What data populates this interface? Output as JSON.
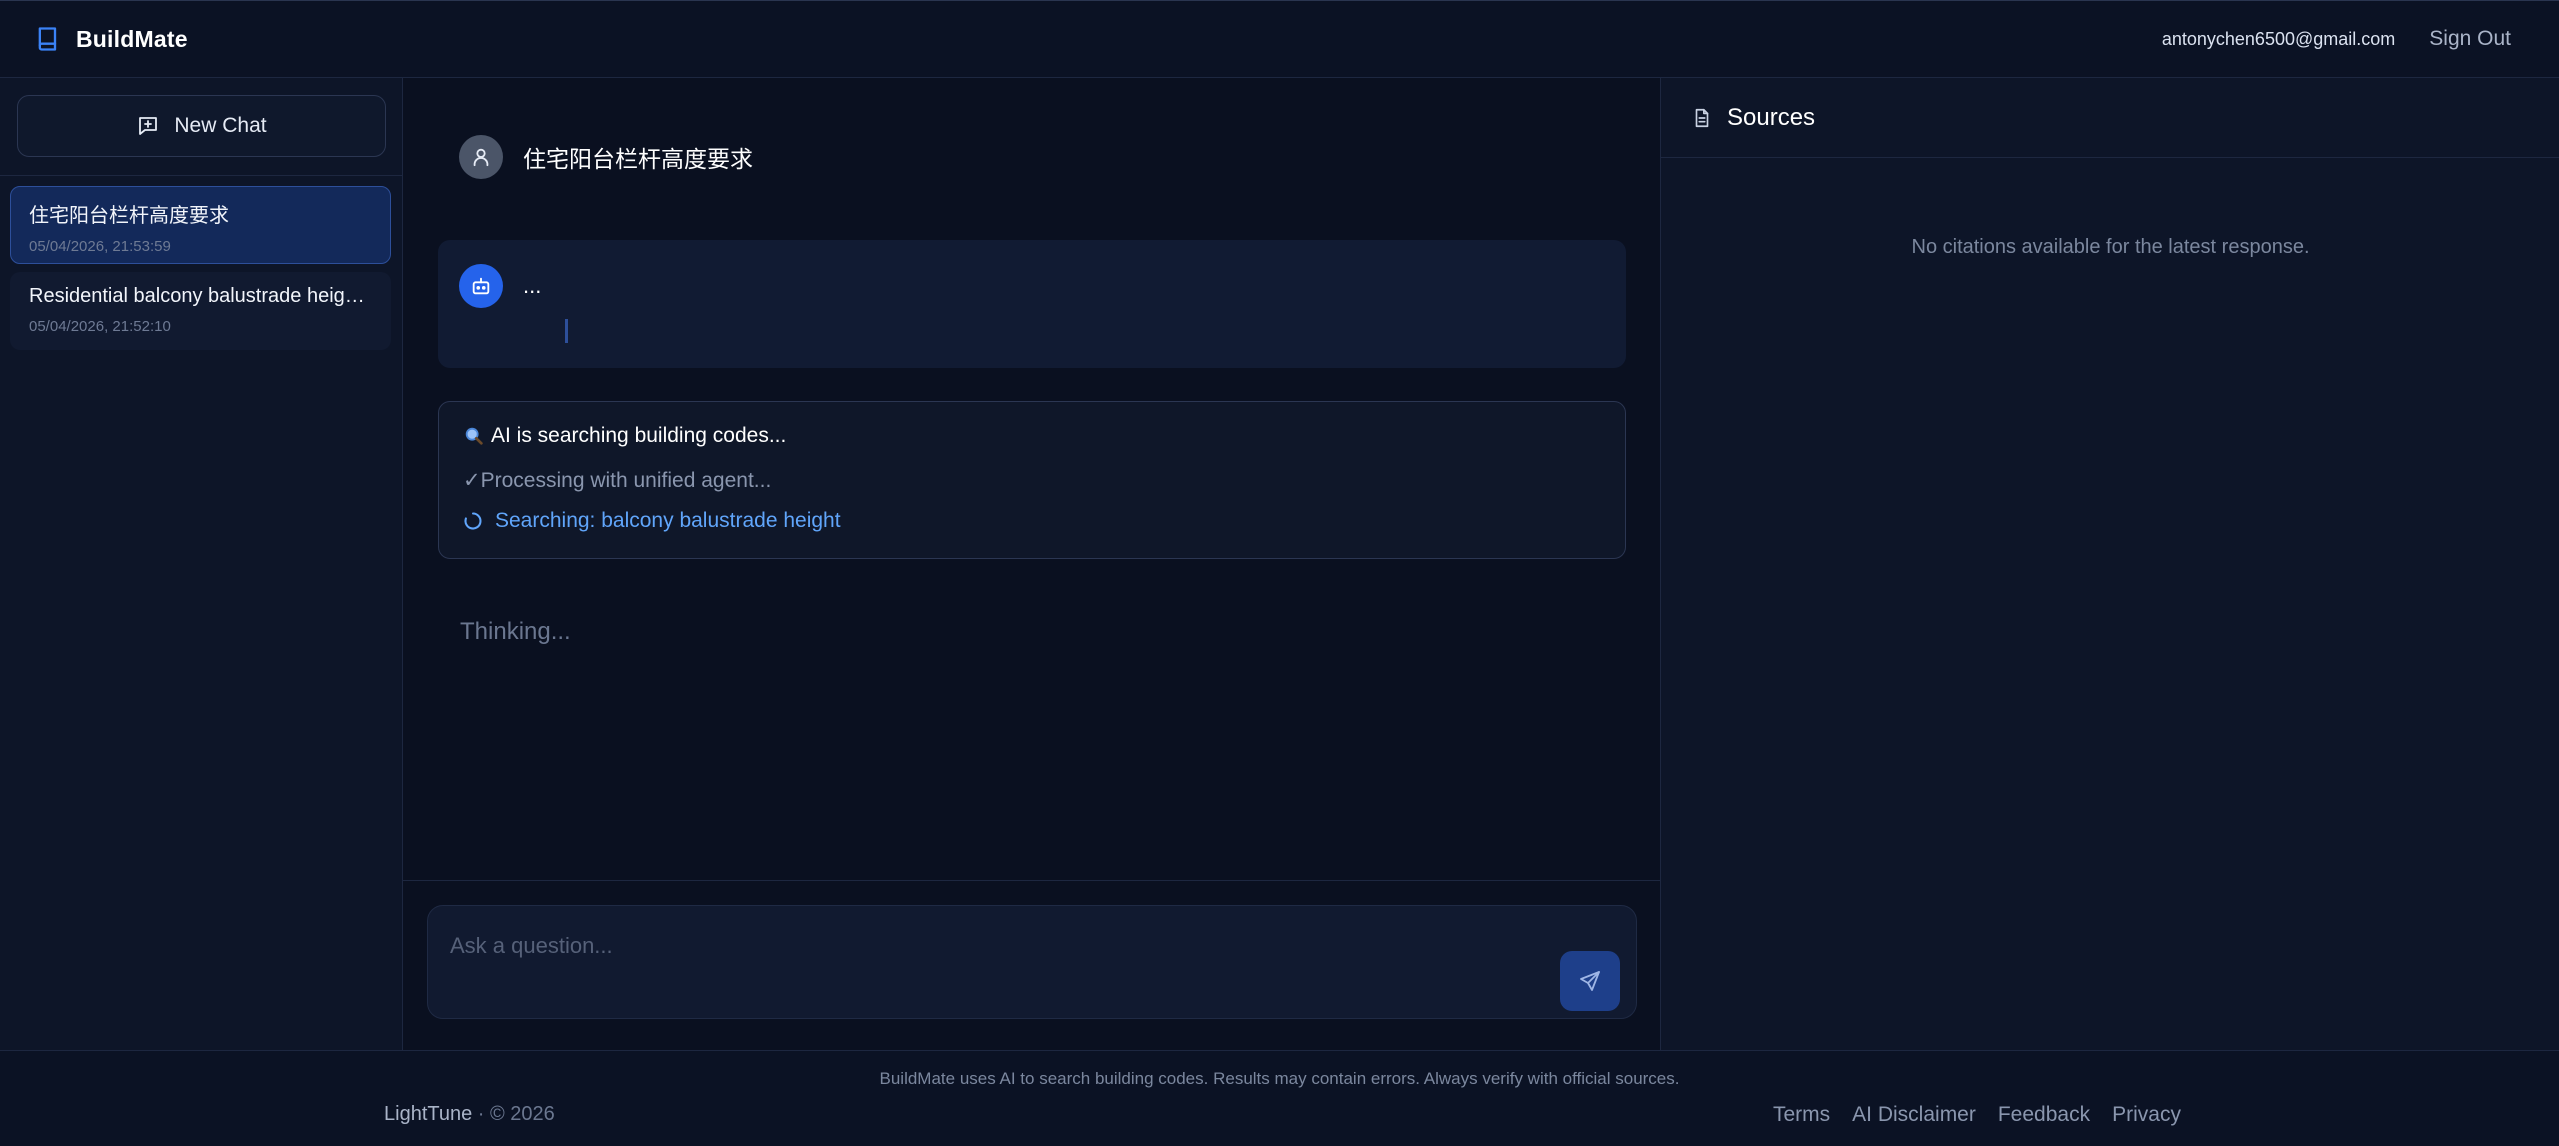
{
  "header": {
    "brand": "BuildMate",
    "user_email": "antonychen6500@gmail.com",
    "sign_out": "Sign Out"
  },
  "sidebar": {
    "new_chat_label": "New Chat",
    "chats": [
      {
        "title": "住宅阳台栏杆高度要求",
        "time": "05/04/2026, 21:53:59",
        "active": true
      },
      {
        "title": "Residential balcony balustrade height requirements",
        "time": "05/04/2026, 21:52:10",
        "active": false
      }
    ]
  },
  "conversation": {
    "user_message": "住宅阳台栏杆高度要求",
    "bot_message": "...",
    "status": {
      "heading": "AI is searching building codes...",
      "step_done": "Processing with unified agent...",
      "step_active": "Searching: balcony balustrade height"
    },
    "thinking": "Thinking..."
  },
  "composer": {
    "placeholder": "Ask a question..."
  },
  "sources": {
    "title": "Sources",
    "empty_message": "No citations available for the latest response."
  },
  "footer": {
    "disclaimer": "BuildMate uses AI to search building codes. Results may contain errors. Always verify with official sources.",
    "company": "LightTune",
    "copyright": "© 2026",
    "links": [
      "Terms",
      "AI Disclaimer",
      "Feedback",
      "Privacy"
    ]
  },
  "colors": {
    "accent": "#2563eb",
    "link_active": "#60a5fa",
    "background": "#0a1020"
  }
}
